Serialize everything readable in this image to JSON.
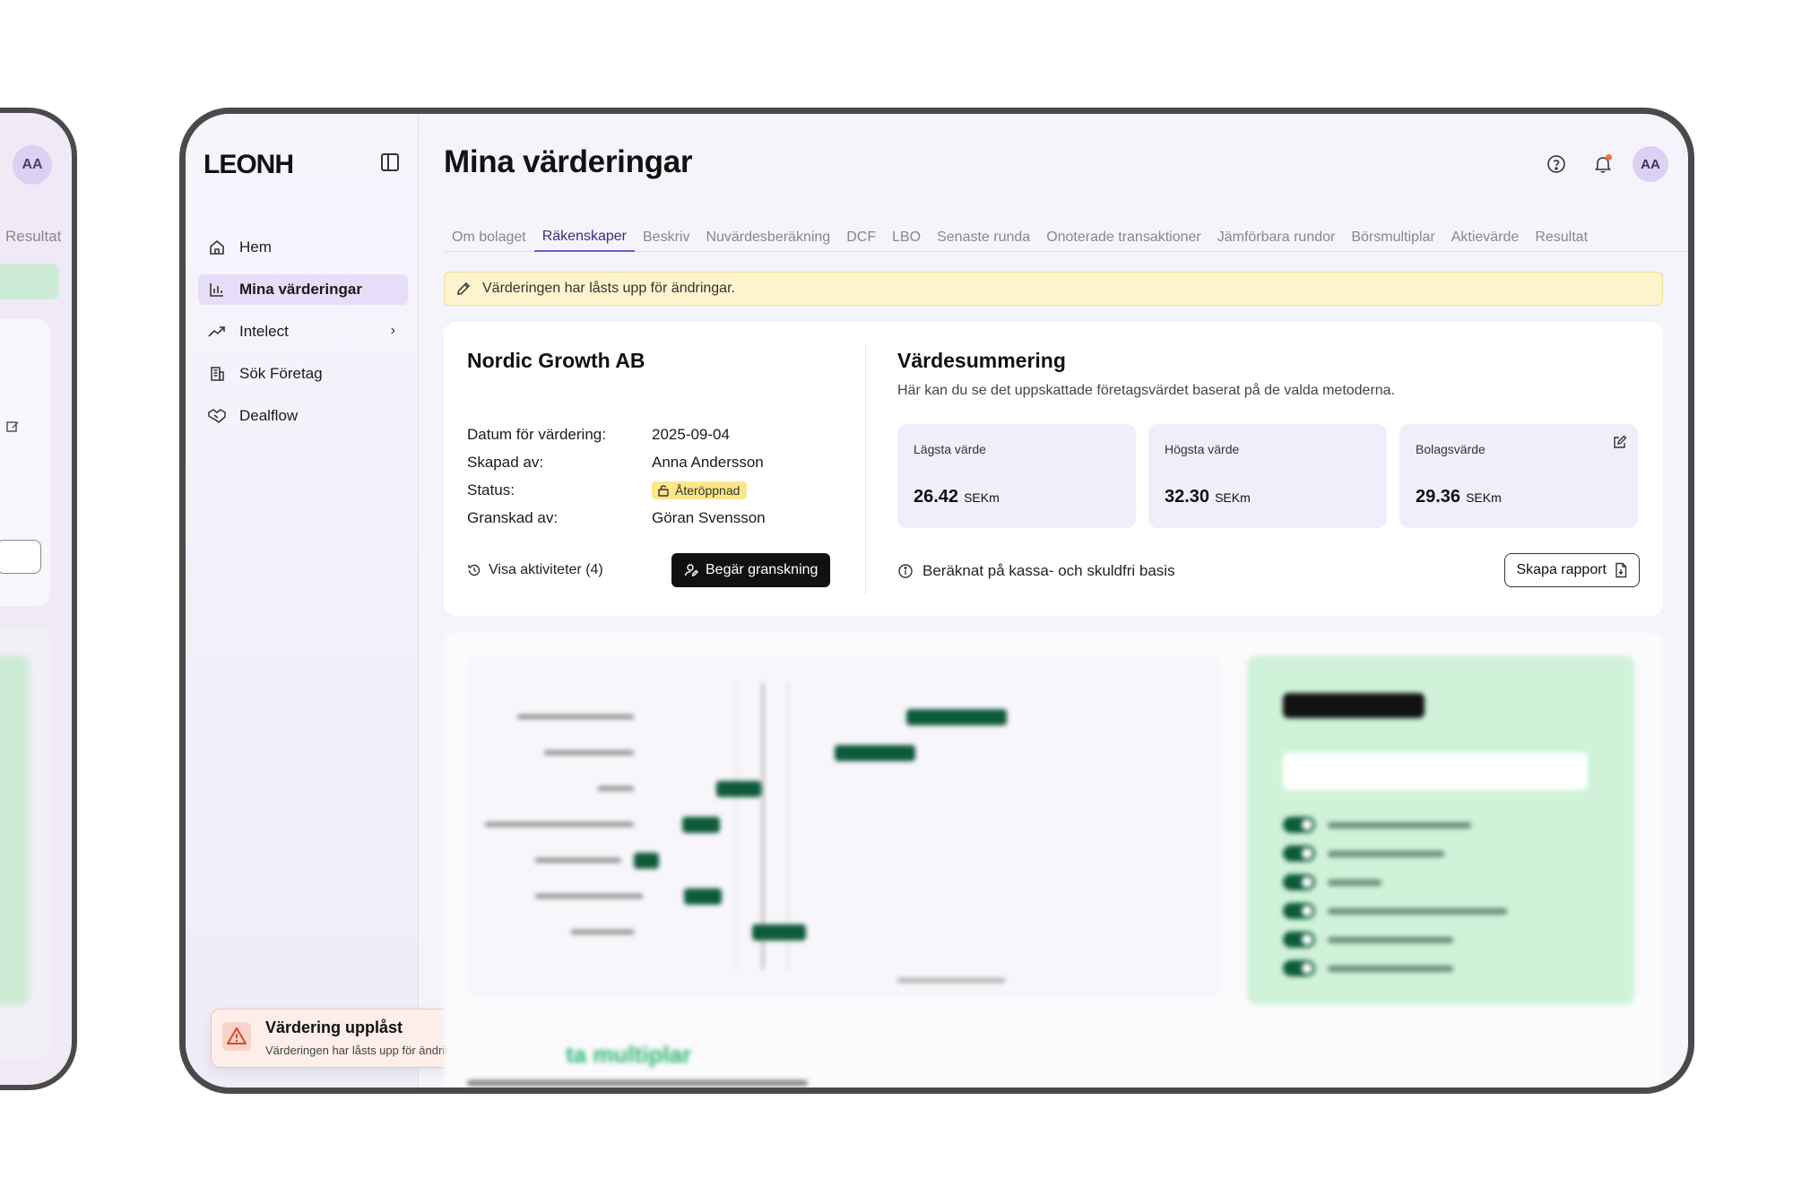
{
  "ghost": {
    "avatar": "AA",
    "tab_label": "Resultat"
  },
  "app": {
    "logo": "LEONH"
  },
  "sidebar": {
    "items": [
      {
        "label": "Hem",
        "icon": "home-icon",
        "active": false
      },
      {
        "label": "Mina värderingar",
        "icon": "bar-chart-icon",
        "active": true
      },
      {
        "label": "Intelect",
        "icon": "trending-up-icon",
        "active": false,
        "has_chevron": true
      },
      {
        "label": "Sök Företag",
        "icon": "building-icon",
        "active": false
      },
      {
        "label": "Dealflow",
        "icon": "handshake-icon",
        "active": false
      }
    ]
  },
  "header": {
    "title": "Mina värderingar",
    "avatar": "AA"
  },
  "tabs": [
    {
      "label": "Om bolaget",
      "active": false
    },
    {
      "label": "Räkenskaper",
      "active": true
    },
    {
      "label": "Beskriv",
      "active": false
    },
    {
      "label": "Nuvärdesberäkning",
      "active": false
    },
    {
      "label": "DCF",
      "active": false
    },
    {
      "label": "LBO",
      "active": false
    },
    {
      "label": "Senaste runda",
      "active": false
    },
    {
      "label": "Onoterade transaktioner",
      "active": false
    },
    {
      "label": "Jämförbara rundor",
      "active": false
    },
    {
      "label": "Börsmultiplar",
      "active": false
    },
    {
      "label": "Aktievärde",
      "active": false
    },
    {
      "label": "Resultat",
      "active": false
    }
  ],
  "alert": {
    "text": "Värderingen har låsts upp för ändringar."
  },
  "company": {
    "name": "Nordic Growth AB",
    "rows": [
      {
        "label": "Datum för värdering:",
        "value": "2025-09-04"
      },
      {
        "label": "Skapad av:",
        "value": "Anna Andersson"
      },
      {
        "label": "Status:",
        "value": "Återöppnad"
      },
      {
        "label": "Granskad av:",
        "value": "Göran Svensson"
      }
    ],
    "activities_link": "Visa aktiviteter (4)",
    "request_button": "Begär granskning"
  },
  "summary": {
    "title": "Värdesummering",
    "description": "Här kan du se det uppskattade företagsvärdet baserat på de valda metoderna.",
    "boxes": [
      {
        "label": "Lägsta värde",
        "value": "26.42",
        "unit": "SEKm"
      },
      {
        "label": "Högsta värde",
        "value": "32.30",
        "unit": "SEKm"
      },
      {
        "label": "Bolagsvärde",
        "value": "29.36",
        "unit": "SEKm"
      }
    ],
    "basis_note": "Beräknat på kassa- och skuldfri basis",
    "report_button": "Skapa rapport"
  },
  "toast": {
    "title": "Värdering upplåst",
    "text": "Värderingen har låsts upp för ändringar"
  },
  "lower": {
    "heading_partial": "ta multiplar"
  },
  "colors": {
    "accent": "#6c5bd4",
    "active_nav_bg": "#e6def8",
    "alert_bg": "#fdf3cd",
    "badge_bg": "#fde78a",
    "value_box_bg": "#f1edfb",
    "green_panel": "#cff2d9",
    "bar_green": "#0e5a3b",
    "toast_bg": "#fdeee9"
  }
}
